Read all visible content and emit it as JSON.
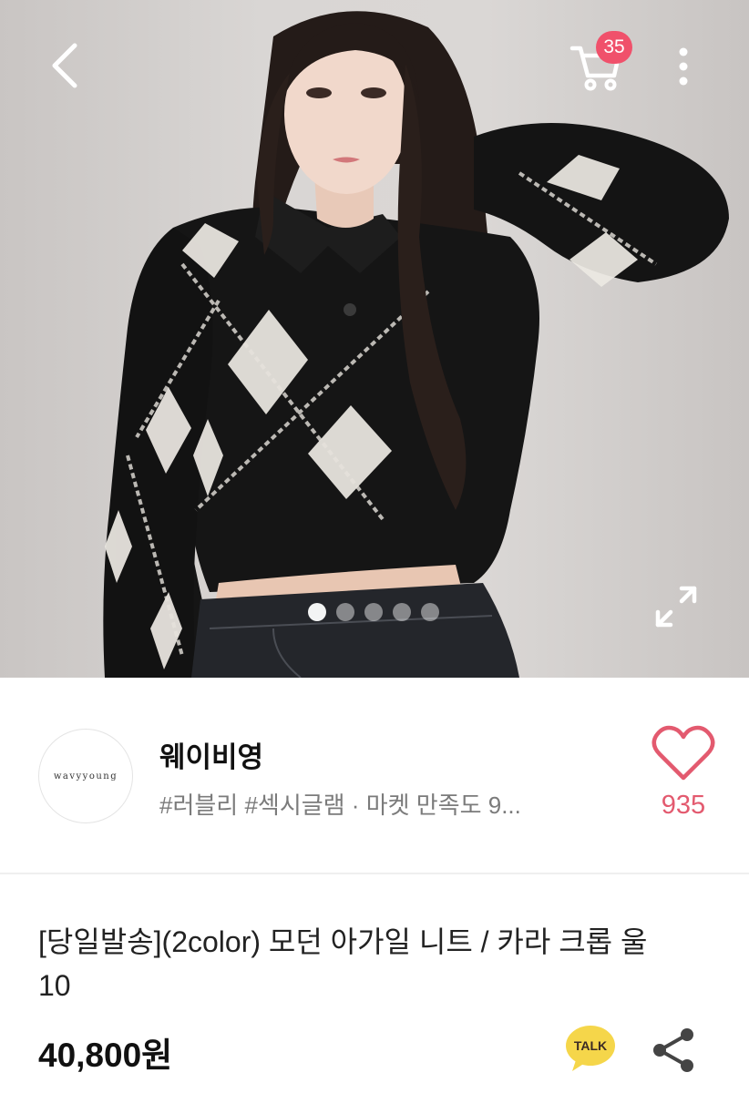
{
  "header": {
    "back_icon": "chevron-left-icon",
    "cart_icon": "cart-icon",
    "cart_badge": "35",
    "more_icon": "more-vertical-icon",
    "badge_color": "#f0516b"
  },
  "gallery": {
    "image_count": 5,
    "active_index": 0,
    "expand_icon": "expand-icon"
  },
  "shop": {
    "logo_text": "wavyyoung",
    "name": "웨이비영",
    "tags": "#러블리 #섹시글램 · 마켓 만족도 9...",
    "like_icon": "heart-outline-icon",
    "like_count": "935",
    "like_color": "#e35a6f"
  },
  "product": {
    "title": "[당일발송](2color) 모던 아가일 니트 / 카라 크롭 울10",
    "price": "40,800원",
    "talk_label": "TALK",
    "talk_color": "#f5d64a",
    "share_icon": "share-icon"
  }
}
